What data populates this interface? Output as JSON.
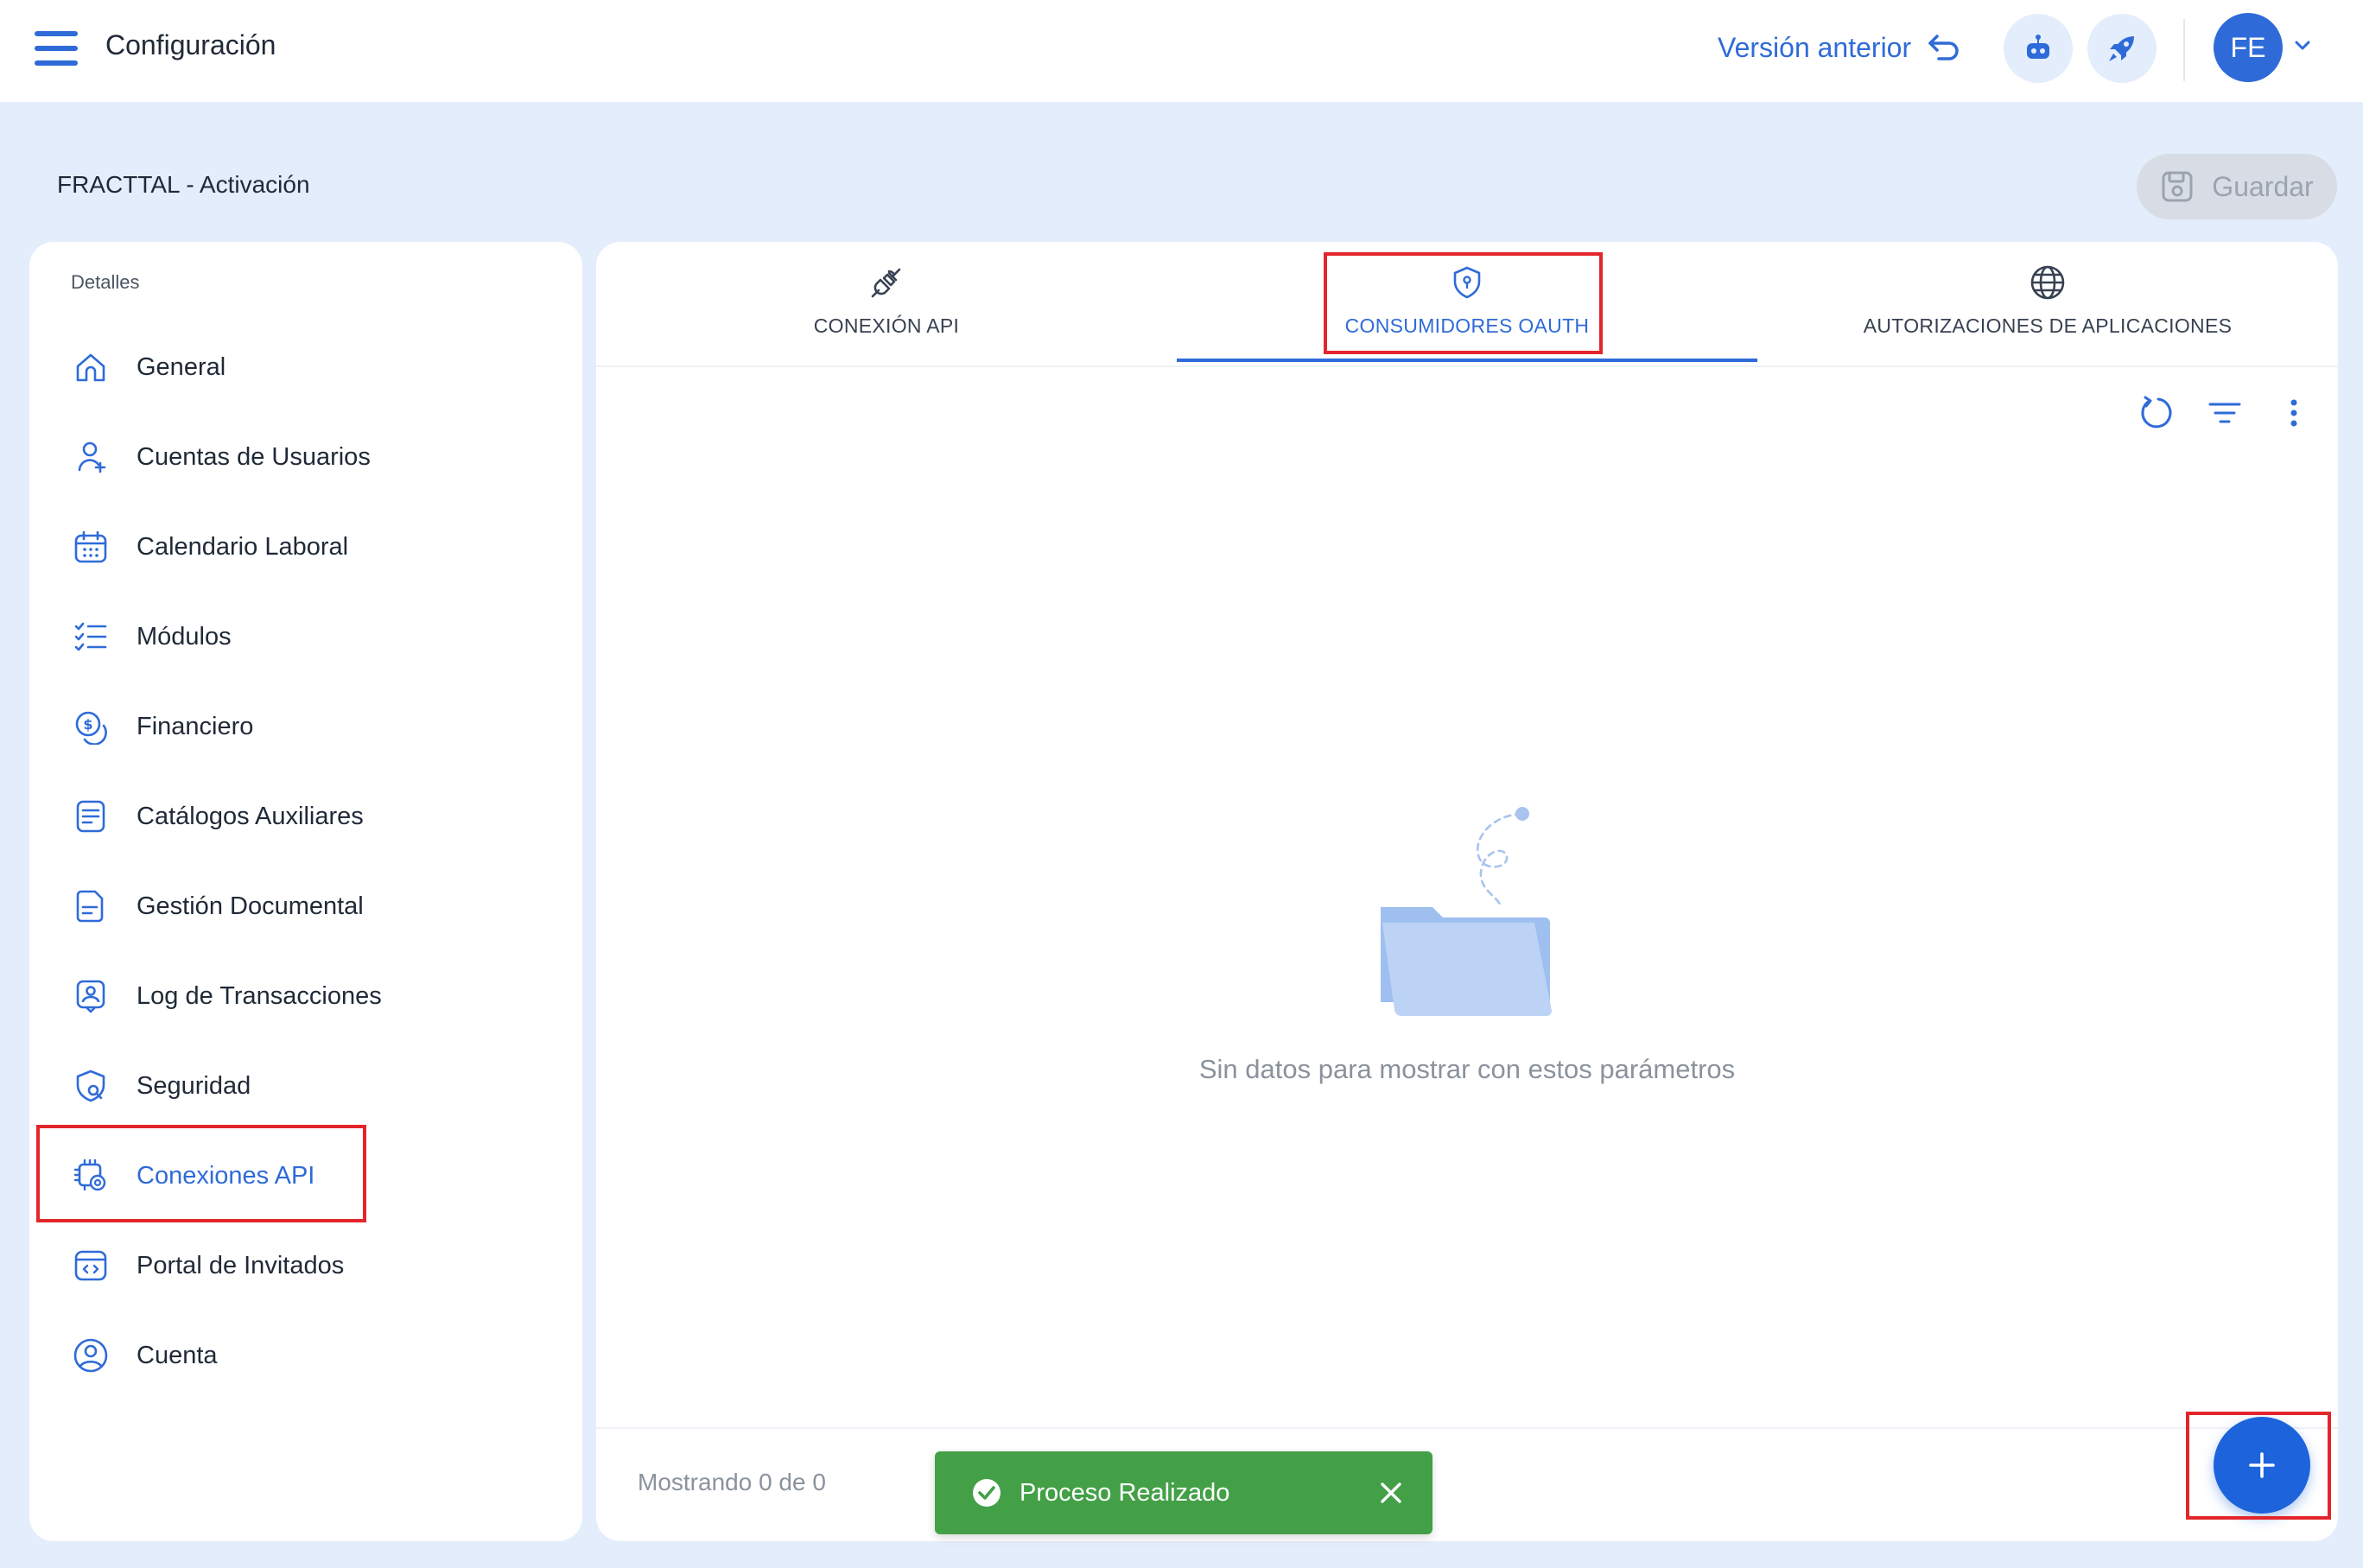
{
  "topbar": {
    "title": "Configuración",
    "prev_version_label": "Versión anterior",
    "avatar_initials": "FE"
  },
  "subheader": {
    "org_name": "FRACTTAL - Activación",
    "save_label": "Guardar"
  },
  "sidebar": {
    "heading": "Detalles",
    "items": [
      {
        "label": "General",
        "icon": "home-icon"
      },
      {
        "label": "Cuentas de Usuarios",
        "icon": "user-add-icon"
      },
      {
        "label": "Calendario Laboral",
        "icon": "calendar-icon"
      },
      {
        "label": "Módulos",
        "icon": "checklist-icon"
      },
      {
        "label": "Financiero",
        "icon": "coin-icon"
      },
      {
        "label": "Catálogos Auxiliares",
        "icon": "catalog-icon"
      },
      {
        "label": "Gestión Documental",
        "icon": "document-icon"
      },
      {
        "label": "Log de Transacciones",
        "icon": "log-icon"
      },
      {
        "label": "Seguridad",
        "icon": "shield-search-icon"
      },
      {
        "label": "Conexiones API",
        "icon": "api-gear-icon",
        "active": true
      },
      {
        "label": "Portal de Invitados",
        "icon": "code-window-icon"
      },
      {
        "label": "Cuenta",
        "icon": "account-circle-icon"
      }
    ]
  },
  "tabs": [
    {
      "label": "CONEXIÓN API",
      "icon": "plug-icon"
    },
    {
      "label": "CONSUMIDORES OAUTH",
      "icon": "shield-key-icon",
      "active": true
    },
    {
      "label": "AUTORIZACIONES DE APLICACIONES",
      "icon": "globe-icon"
    }
  ],
  "main": {
    "empty_text": "Sin datos para mostrar con estos parámetros",
    "showing_text": "Mostrando 0 de 0"
  },
  "toast": {
    "message": "Proceso Realizado"
  },
  "colors": {
    "accent": "#2f6bd8",
    "background": "#e4edfb",
    "success": "#43a047",
    "highlight": "#e3262b"
  }
}
